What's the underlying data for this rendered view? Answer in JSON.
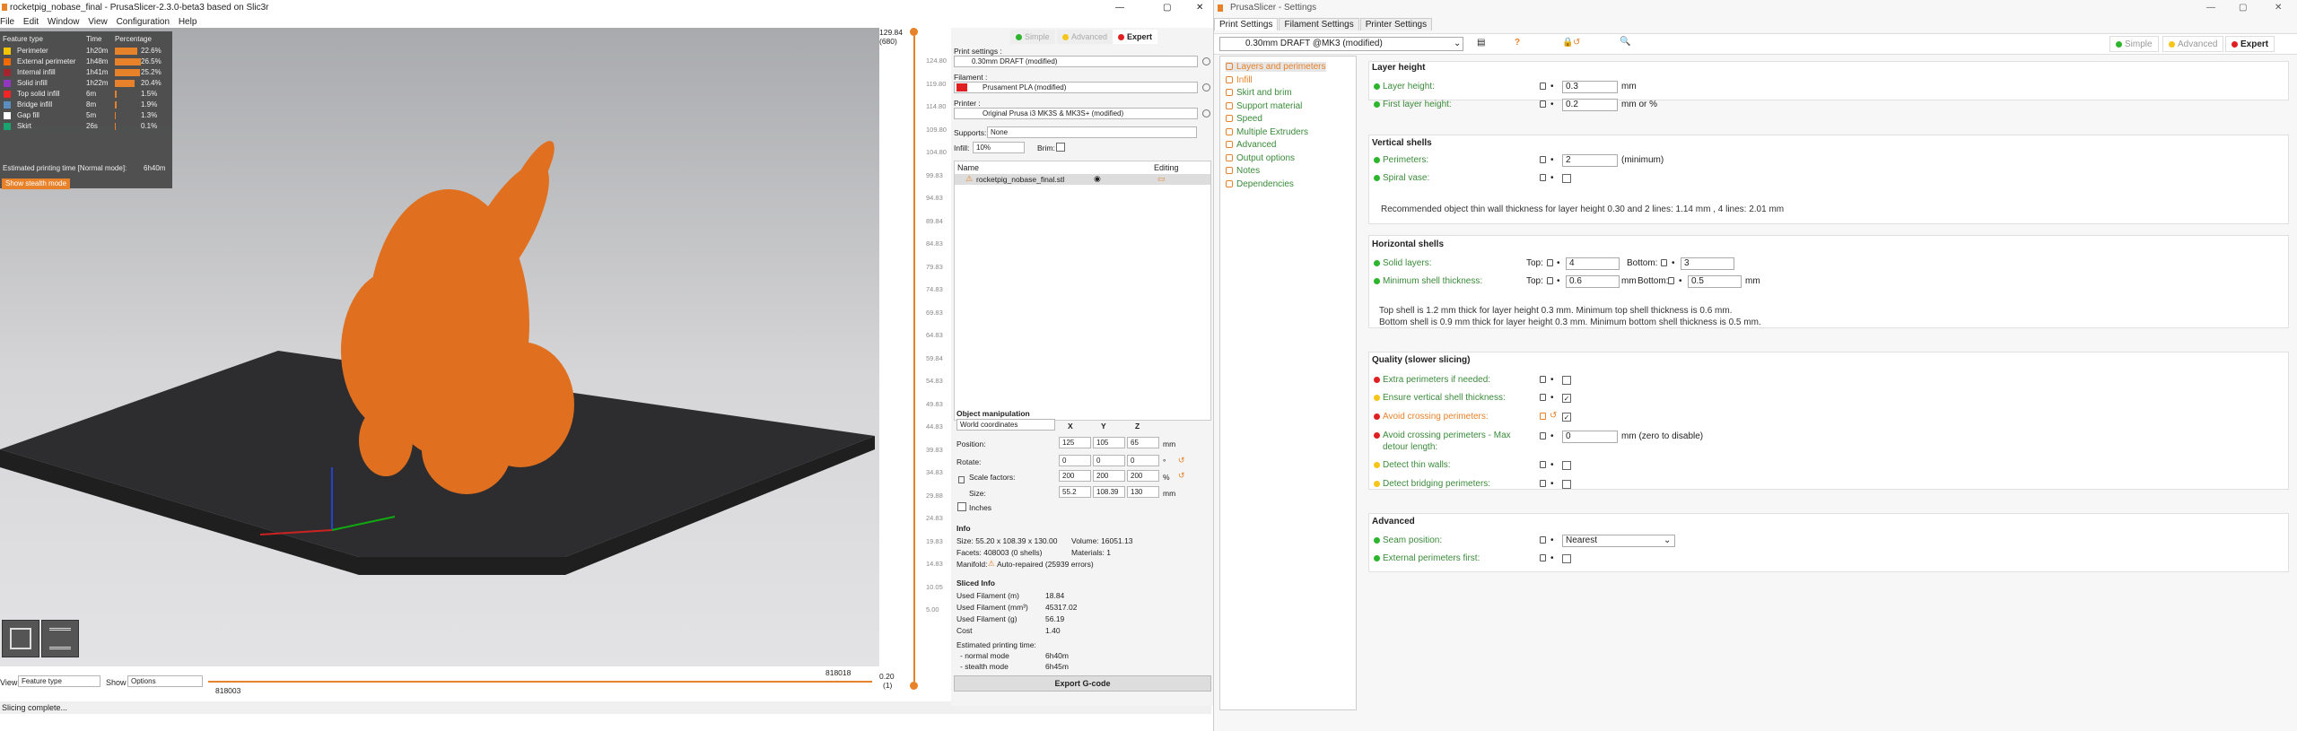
{
  "win1": {
    "title": "rocketpig_nobase_final - PrusaSlicer-2.3.0-beta3 based on Slic3r",
    "menu": [
      "File",
      "Edit",
      "Window",
      "View",
      "Configuration",
      "Help"
    ]
  },
  "legend": {
    "headers": [
      "Feature type",
      "Time",
      "Percentage"
    ],
    "rows": [
      {
        "name": "Perimeter",
        "time": "1h20m",
        "pct": "22.6%",
        "frac": 0.226,
        "color": "#f6c400"
      },
      {
        "name": "External perimeter",
        "time": "1h48m",
        "pct": "26.5%",
        "frac": 0.265,
        "color": "#f36b00"
      },
      {
        "name": "Internal infill",
        "time": "1h41m",
        "pct": "25.2%",
        "frac": 0.252,
        "color": "#a4252e"
      },
      {
        "name": "Solid infill",
        "time": "1h22m",
        "pct": "20.4%",
        "frac": 0.204,
        "color": "#9437c0"
      },
      {
        "name": "Top solid infill",
        "time": "6m",
        "pct": "1.5%",
        "frac": 0.015,
        "color": "#f02525"
      },
      {
        "name": "Bridge infill",
        "time": "8m",
        "pct": "1.9%",
        "frac": 0.019,
        "color": "#5b8ec0"
      },
      {
        "name": "Gap fill",
        "time": "5m",
        "pct": "1.3%",
        "frac": 0.013,
        "color": "#ffffff"
      },
      {
        "name": "Skirt",
        "time": "26s",
        "pct": "0.1%",
        "frac": 0.001,
        "color": "#1aa36e"
      }
    ],
    "est": "Estimated printing time [Normal mode]:",
    "est_val": "6h40m",
    "stealth": "Show stealth mode"
  },
  "vslider": {
    "top": "129.84",
    "top2": "(680)",
    "bottom": "0.20",
    "bottom2": "(1)",
    "ticks": [
      "124.80",
      "119.80",
      "114.80",
      "109.80",
      "104.80",
      "99.83",
      "94.83",
      "89.84",
      "84.83",
      "79.83",
      "74.83",
      "69.83",
      "64.83",
      "59.84",
      "54.83",
      "49.83",
      "44.83",
      "39.83",
      "34.83",
      "29.88",
      "24.83",
      "19.83",
      "14.83",
      "10.05",
      "5.00"
    ]
  },
  "hslider": {
    "left": "818003",
    "right": "818018",
    "view_label": "View",
    "view_value": "Feature type",
    "show_label": "Show",
    "show_value": "Options"
  },
  "status": "Slicing complete...",
  "side": {
    "modes": [
      "Simple",
      "Advanced",
      "Expert"
    ],
    "print_label": "Print settings :",
    "print_value": "0.30mm DRAFT (modified)",
    "filament_label": "Filament :",
    "filament_value": "Prusament PLA (modified)",
    "printer_label": "Printer :",
    "printer_value": "Original Prusa i3 MK3S & MK3S+ (modified)",
    "supports_label": "Supports:",
    "supports_value": "None",
    "infill_label": "Infill:",
    "infill_value": "10%",
    "brim_label": "Brim:",
    "col_name": "Name",
    "col_editing": "Editing",
    "object": "rocketpig_nobase_final.stl",
    "om_title": "Object manipulation",
    "coords": "World coordinates",
    "xyz": [
      "X",
      "Y",
      "Z"
    ],
    "position_label": "Position:",
    "position": [
      "125",
      "105",
      "65"
    ],
    "pos_unit": "mm",
    "rotate_label": "Rotate:",
    "rotate": [
      "0",
      "0",
      "0"
    ],
    "rot_unit": "°",
    "scale_label": "Scale factors:",
    "scale": [
      "200",
      "200",
      "200"
    ],
    "scale_unit": "%",
    "size_label": "Size:",
    "size": [
      "55.2",
      "108.39",
      "130"
    ],
    "size_unit": "mm",
    "inches": "Inches",
    "info_title": "Info",
    "info_size": "Size:  55.20 x 108.39 x 130.00",
    "info_volume": "Volume:    16051.13",
    "info_facets": "Facets:  408003 (0 shells)",
    "info_materials": "Materials:   1",
    "info_manifold": "Manifold:",
    "info_repaired": "Auto-repaired (25939 errors)",
    "sliced_title": "Sliced Info",
    "sliced": [
      [
        "Used Filament (m)",
        "18.84"
      ],
      [
        "Used Filament (mm³)",
        "45317.02"
      ],
      [
        "Used Filament (g)",
        "56.19"
      ],
      [
        "Cost",
        "1.40"
      ]
    ],
    "est_title": "Estimated printing time:",
    "normal": "- normal mode",
    "normal_val": "6h40m",
    "stealth": "- stealth mode",
    "stealth_val": "6h45m",
    "export": "Export G-code"
  },
  "win2": {
    "title": "PrusaSlicer - Settings",
    "tabs": [
      "Print Settings",
      "Filament Settings",
      "Printer Settings"
    ],
    "preset": "0.30mm DRAFT @MK3 (modified)",
    "modes": [
      "Simple",
      "Advanced",
      "Expert"
    ]
  },
  "tree": [
    "Layers and perimeters",
    "Infill",
    "Skirt and brim",
    "Support material",
    "Speed",
    "Multiple Extruders",
    "Advanced",
    "Output options",
    "Notes",
    "Dependencies"
  ],
  "settings": {
    "layer_h": "Layer height",
    "layer_height_label": "Layer height:",
    "layer_height": "0.3",
    "mm": "mm",
    "first_layer_label": "First layer height:",
    "first_layer": "0.2",
    "mm_or_pct": "mm or %",
    "vshell": "Vertical shells",
    "perimeters_label": "Perimeters:",
    "perimeters": "2",
    "minimum": "(minimum)",
    "spiral_label": "Spiral vase:",
    "vshell_note": "Recommended object thin wall thickness for layer height 0.30 and 2 lines: 1.14 mm , 4 lines: 2.01 mm",
    "hshell": "Horizontal shells",
    "solid_label": "Solid layers:",
    "top": "Top:",
    "bottom": "Bottom:",
    "solid_top": "4",
    "solid_bottom": "3",
    "min_shell_label": "Minimum shell thickness:",
    "min_top": "0.6",
    "min_bottom": "0.5",
    "hshell_note1": "Top shell is 1.2 mm thick for layer height 0.3 mm. Minimum top shell thickness is 0.6 mm.",
    "hshell_note2": "Bottom shell is 0.9 mm thick for layer height 0.3 mm. Minimum bottom shell thickness is 0.5 mm.",
    "quality": "Quality (slower slicing)",
    "extra_label": "Extra perimeters if needed:",
    "ensure_label": "Ensure vertical shell thickness:",
    "avoid_label": "Avoid crossing perimeters:",
    "avoid_max_label": "Avoid crossing perimeters - Max",
    "avoid_max_label2": "detour length:",
    "avoid_max": "0",
    "avoid_max_unit": "mm (zero to disable)",
    "thin_label": "Detect thin walls:",
    "bridging_label": "Detect bridging perimeters:",
    "advanced": "Advanced",
    "seam_label": "Seam position:",
    "seam": "Nearest",
    "ext_first_label": "External perimeters first:"
  }
}
